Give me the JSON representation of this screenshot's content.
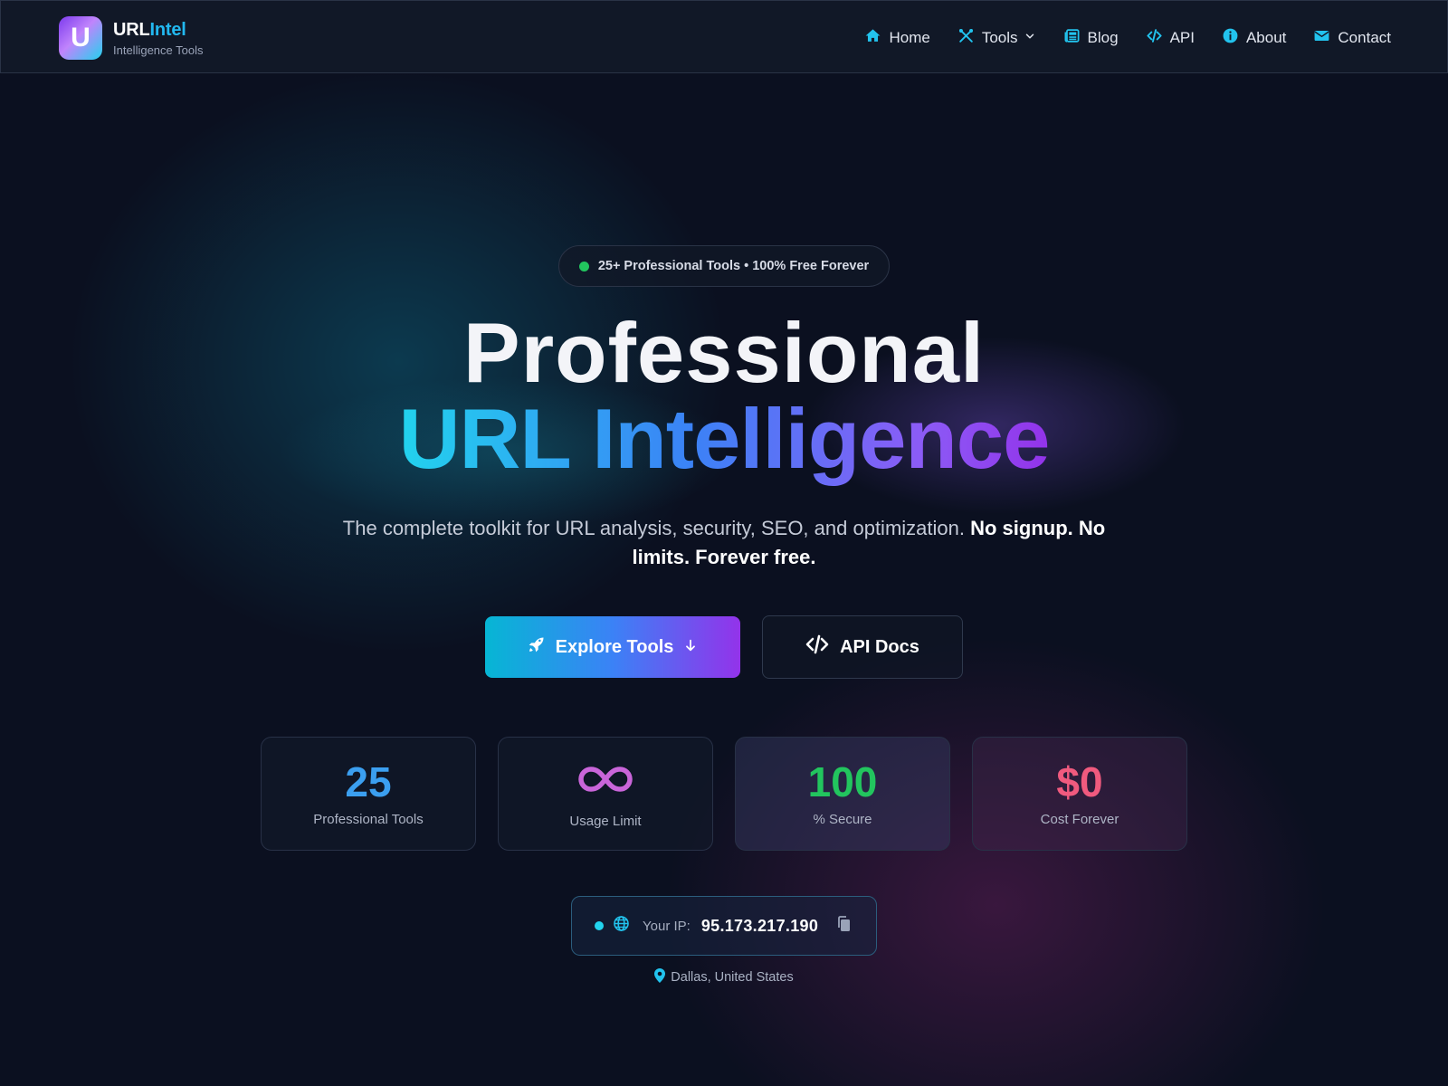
{
  "brand": {
    "logo_letter": "U",
    "name_part1": "URL",
    "name_part2": "Intel",
    "subtitle": "Intelligence Tools"
  },
  "nav": {
    "items": [
      {
        "label": "Home",
        "icon": "home-icon"
      },
      {
        "label": "Tools",
        "icon": "tools-icon"
      },
      {
        "label": "Blog",
        "icon": "newspaper-icon"
      },
      {
        "label": "API",
        "icon": "code-icon"
      },
      {
        "label": "About",
        "icon": "info-icon"
      },
      {
        "label": "Contact",
        "icon": "envelope-icon"
      }
    ]
  },
  "hero": {
    "badge": "25+ Professional Tools • 100% Free Forever",
    "title_line1": "Professional",
    "title_line2": "URL Intelligence",
    "subtitle_plain": "The complete toolkit for URL analysis, security, SEO, and optimization.",
    "subtitle_bold": "No signup. No limits. Forever free.",
    "primary_button": "Explore Tools",
    "secondary_button": "API Docs"
  },
  "stats": [
    {
      "value": "25",
      "label": "Professional Tools",
      "color": "#3b9ff0"
    },
    {
      "value": "∞",
      "label": "Usage Limit",
      "color": "#c965d9"
    },
    {
      "value": "100",
      "label": "% Secure",
      "color": "#22c55e"
    },
    {
      "value": "$0",
      "label": "Cost Forever",
      "color": "#f05a7e"
    }
  ],
  "ip": {
    "label": "Your IP:",
    "value": "95.173.217.190",
    "location": "Dallas, United States"
  },
  "colors": {
    "accent_cyan": "#22d3ee",
    "accent_blue": "#3b82f6",
    "accent_purple": "#9333ea",
    "background": "#0b1020"
  }
}
